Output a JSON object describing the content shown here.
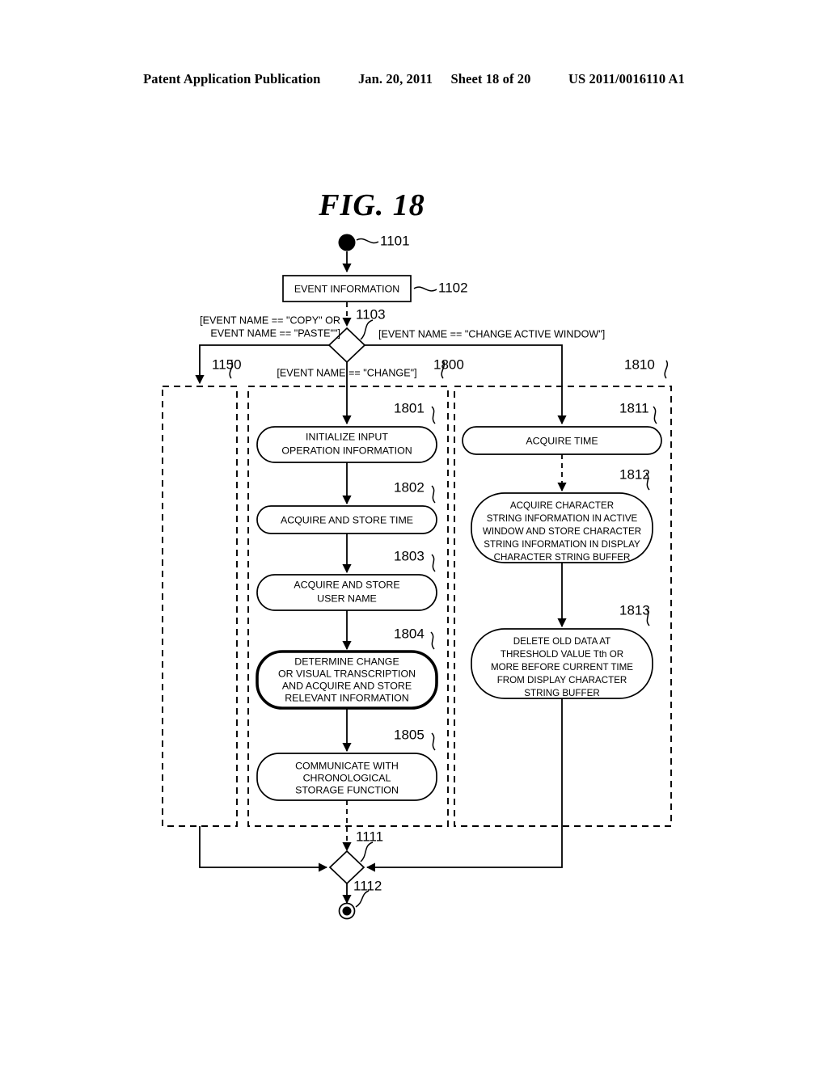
{
  "header": {
    "publication": "Patent Application Publication",
    "date": "Jan. 20, 2011",
    "sheet": "Sheet 18 of 20",
    "doc_number": "US 2011/0016110 A1"
  },
  "figure": {
    "title": "FIG.  18"
  },
  "diagram": {
    "type": "activity-flowchart",
    "start_node": {
      "ref": "1101",
      "label": ""
    },
    "end_node": {
      "ref": "1112",
      "label": ""
    },
    "nodes": [
      {
        "ref": "1102",
        "shape": "rect",
        "label": "EVENT INFORMATION"
      },
      {
        "ref": "1103",
        "shape": "diamond",
        "label": ""
      },
      {
        "ref": "1801",
        "shape": "rounded",
        "label": "INITIALIZE INPUT\nOPERATION INFORMATION"
      },
      {
        "ref": "1802",
        "shape": "rounded",
        "label": "ACQUIRE AND STORE TIME"
      },
      {
        "ref": "1803",
        "shape": "rounded",
        "label": "ACQUIRE AND STORE\nUSER NAME"
      },
      {
        "ref": "1804",
        "shape": "rounded-bold",
        "label": "DETERMINE CHANGE\nOR VISUAL TRANSCRIPTION\nAND ACQUIRE AND STORE\nRELEVANT INFORMATION"
      },
      {
        "ref": "1805",
        "shape": "rounded",
        "label": "COMMUNICATE WITH\nCHRONOLOGICAL\nSTORAGE FUNCTION"
      },
      {
        "ref": "1811",
        "shape": "rounded",
        "label": "ACQUIRE TIME"
      },
      {
        "ref": "1812",
        "shape": "rounded",
        "label": "ACQUIRE CHARACTER\nSTRING INFORMATION IN ACTIVE\nWINDOW AND STORE CHARACTER\nSTRING INFORMATION IN DISPLAY\nCHARACTER STRING BUFFER"
      },
      {
        "ref": "1813",
        "shape": "rounded",
        "label": "DELETE OLD DATA AT\nTHRESHOLD VALUE Tth OR\nMORE BEFORE CURRENT TIME\nFROM DISPLAY CHARACTER\nSTRING BUFFER"
      },
      {
        "ref": "1111",
        "shape": "diamond",
        "label": ""
      }
    ],
    "containers": [
      {
        "ref": "1150",
        "label": ""
      },
      {
        "ref": "1800",
        "label": ""
      },
      {
        "ref": "1810",
        "label": ""
      }
    ],
    "guards": {
      "copy_paste_line1": "[EVENT NAME == \"COPY\" OR",
      "copy_paste_line2": "EVENT NAME == \"PASTE\"\"]",
      "change_active_window": "[EVENT NAME == \"CHANGE ACTIVE WINDOW\"]",
      "change": "[EVENT NAME == \"CHANGE\"]"
    },
    "labels": {
      "n1101": "1101",
      "n1102": "1102",
      "n1103": "1103",
      "n1150": "1150",
      "n1800": "1800",
      "n1810": "1810",
      "n1801": "1801",
      "n1802": "1802",
      "n1803": "1803",
      "n1804": "1804",
      "n1805": "1805",
      "n1811": "1811",
      "n1812": "1812",
      "n1813": "1813",
      "n1111": "1111",
      "n1112": "1112"
    },
    "node_text": {
      "t1102": "EVENT INFORMATION",
      "t1801_a": "INITIALIZE INPUT",
      "t1801_b": "OPERATION INFORMATION",
      "t1802_a": "ACQUIRE AND STORE TIME",
      "t1803_a": "ACQUIRE AND STORE",
      "t1803_b": "USER NAME",
      "t1804_a": "DETERMINE CHANGE",
      "t1804_b": "OR VISUAL TRANSCRIPTION",
      "t1804_c": "AND ACQUIRE AND STORE",
      "t1804_d": "RELEVANT INFORMATION",
      "t1805_a": "COMMUNICATE WITH",
      "t1805_b": "CHRONOLOGICAL",
      "t1805_c": "STORAGE FUNCTION",
      "t1811_a": "ACQUIRE TIME",
      "t1812_a": "ACQUIRE CHARACTER",
      "t1812_b": "STRING INFORMATION IN ACTIVE",
      "t1812_c": "WINDOW AND STORE CHARACTER",
      "t1812_d": "STRING INFORMATION IN DISPLAY",
      "t1812_e": "CHARACTER STRING BUFFER",
      "t1813_a": "DELETE OLD DATA AT",
      "t1813_b": "THRESHOLD VALUE Tth OR",
      "t1813_c": "MORE BEFORE CURRENT TIME",
      "t1813_d": "FROM DISPLAY CHARACTER",
      "t1813_e": "STRING BUFFER"
    }
  },
  "colors": {
    "ink": "#000000",
    "paper": "#ffffff"
  }
}
